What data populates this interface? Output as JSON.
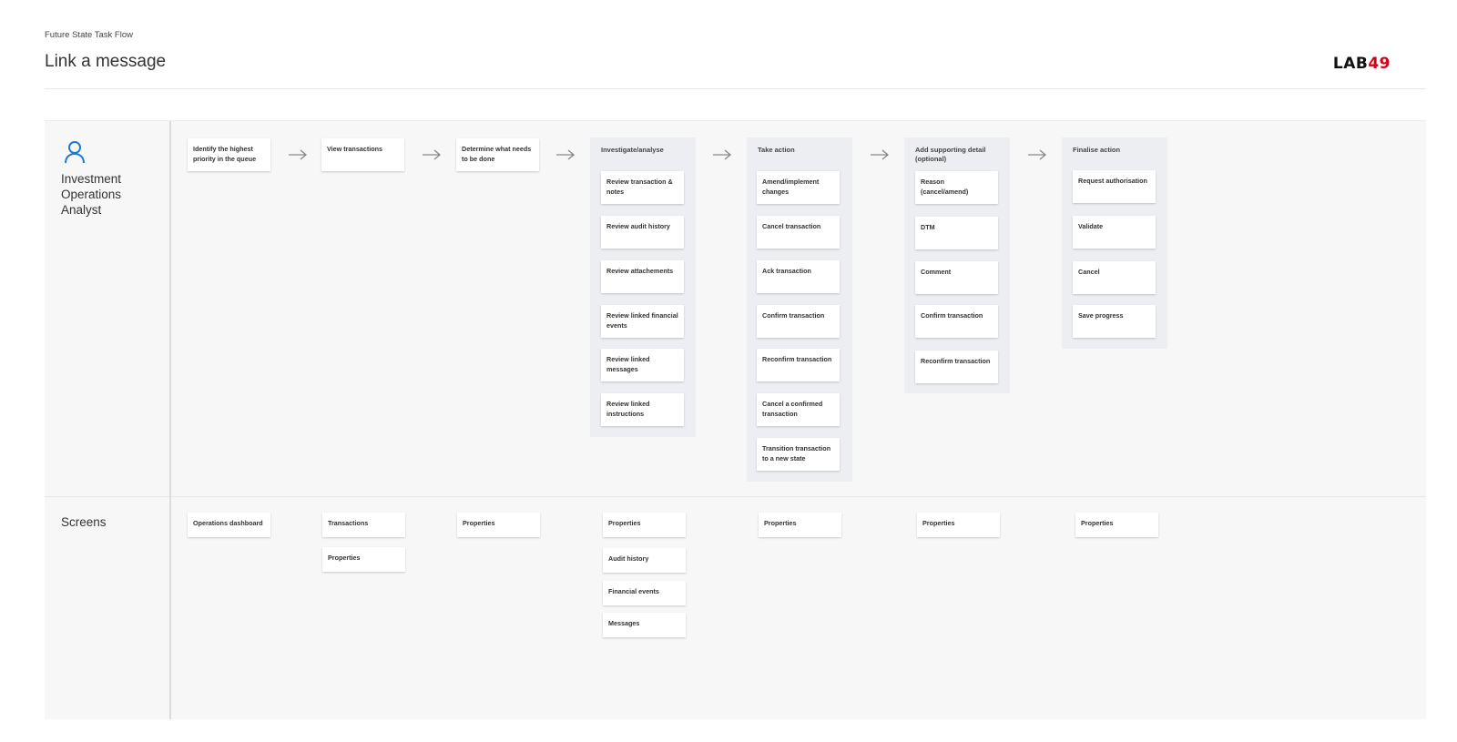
{
  "header": {
    "eyebrow": "Future State Task Flow",
    "title": "Link a message",
    "logo_text": "LAB",
    "logo_number": "49"
  },
  "colors": {
    "accent_icon": "#1c7bd6",
    "logo_red": "#d0021b"
  },
  "persona": {
    "label": "Investment Operations Analyst",
    "icon": "user-icon"
  },
  "steps": [
    {
      "label": "Identify the highest priority in the queue"
    },
    {
      "label": "View transactions"
    },
    {
      "label": "Determine what needs to be done"
    }
  ],
  "groups": [
    {
      "title": "Investigate/analyse",
      "items": [
        "Review transaction & notes",
        "Review audit history",
        "Review attachements",
        "Review linked financial events",
        "Review linked messages",
        "Review linked instructions"
      ]
    },
    {
      "title": "Take action",
      "items": [
        "Amend/implement changes",
        "Cancel transaction",
        "Ack transaction",
        "Confirm transaction",
        "Reconfirm transaction",
        "Cancel a confirmed transaction",
        "Transition transaction to a new state"
      ]
    },
    {
      "title": "Add supporting detail (optional)",
      "items": [
        "Reason (cancel/amend)",
        "DTM",
        "Comment",
        "Confirm transaction",
        "Reconfirm transaction"
      ]
    },
    {
      "title": "Finalise action",
      "items": [
        "Request authorisation",
        "Validate",
        "Cancel",
        "Save progress"
      ]
    }
  ],
  "screens_lane": {
    "label": "Screens",
    "columns": [
      [
        "Operations dashboard"
      ],
      [
        "Transactions",
        "Properties"
      ],
      [
        "Properties"
      ],
      [
        "Properties",
        "Audit history",
        "Financial events",
        "Messages"
      ],
      [
        "Properties"
      ],
      [
        "Properties"
      ],
      [
        "Properties"
      ]
    ]
  }
}
